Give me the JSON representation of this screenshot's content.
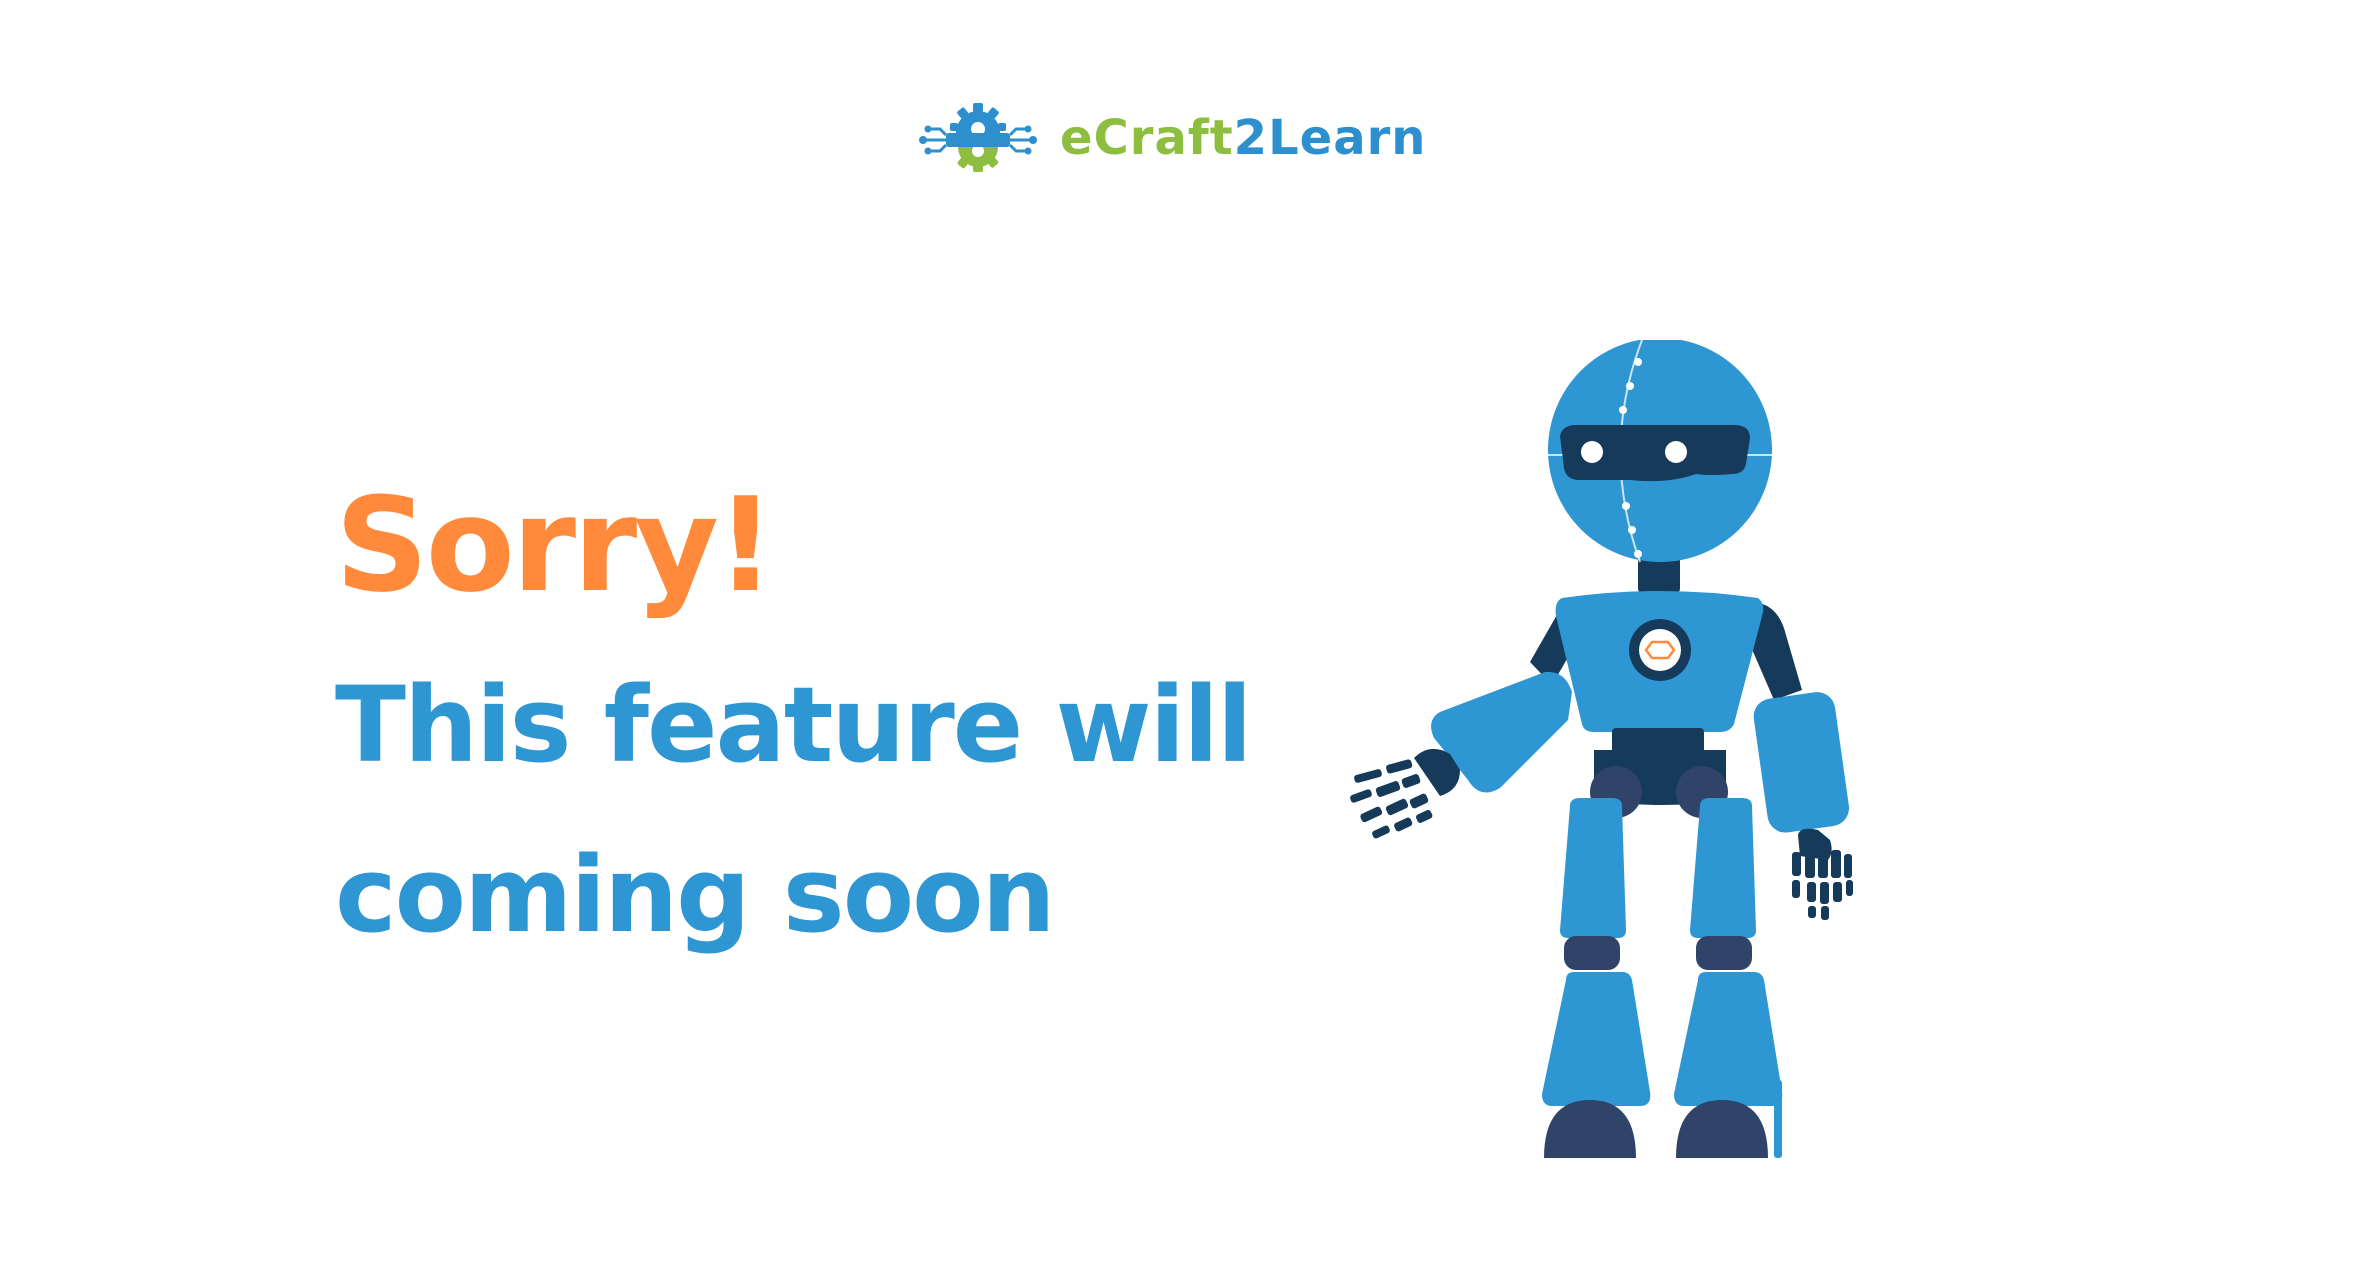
{
  "header": {
    "logo_icon": "gear-circuit-icon",
    "brand": {
      "part1": "eCraft",
      "part2": "2",
      "part3": "Learn"
    }
  },
  "message": {
    "title": "Sorry!",
    "line1": "This feature will",
    "line2": "coming soon"
  },
  "illustration": {
    "name": "robot-illustration",
    "colors": {
      "blue": "#2e96d3",
      "navy": "#163a59",
      "slate": "#2f4468",
      "accent": "#ff8a3c"
    }
  },
  "colors": {
    "orange": "#ff8a3c",
    "blue": "#2e96d3",
    "green": "#8dbe3f",
    "background": "#ffffff"
  }
}
